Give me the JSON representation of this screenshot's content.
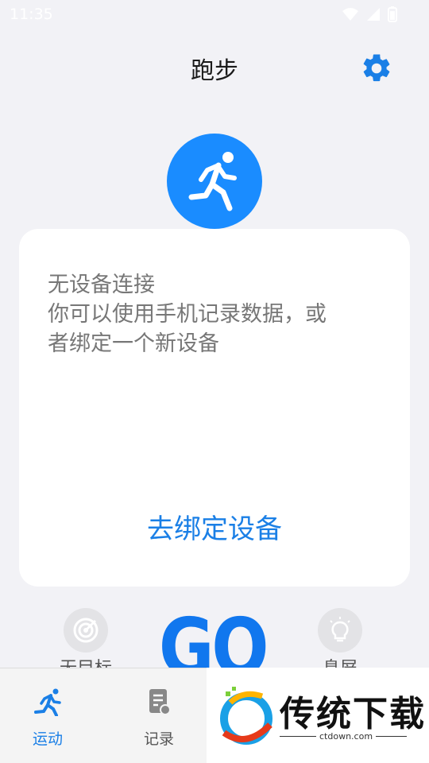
{
  "status": {
    "time": "11:35"
  },
  "header": {
    "title": "跑步"
  },
  "card": {
    "message_lines": [
      "无设备连接",
      "你可以使用手机记录数据，或",
      "者绑定一个新设备"
    ],
    "bind_label": "去绑定设备"
  },
  "modes": {
    "left_label": "无目标",
    "center_label": "GO",
    "right_label": "息屏"
  },
  "tabs": [
    {
      "label": "运动",
      "icon": "running-icon",
      "active": true
    },
    {
      "label": "记录",
      "icon": "record-icon",
      "active": false
    }
  ],
  "watermark": {
    "brand": "传统下载",
    "url": "ctdown.com"
  },
  "colors": {
    "accent": "#1a8cff",
    "background": "#f2f2f6",
    "card": "#ffffff"
  }
}
